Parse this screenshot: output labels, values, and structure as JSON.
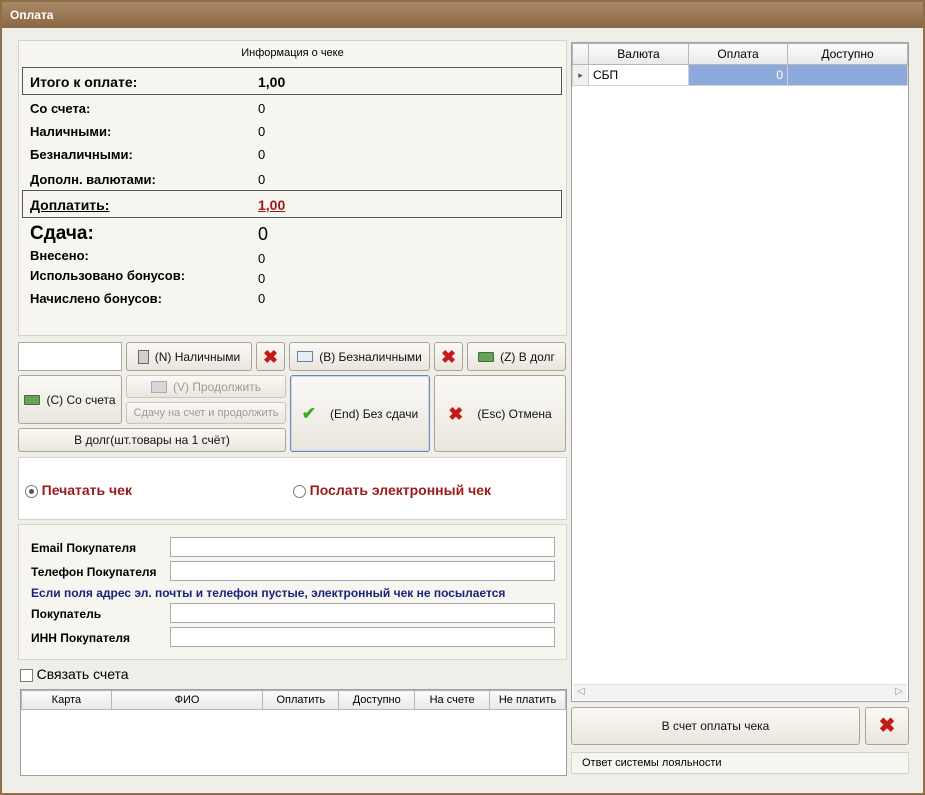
{
  "window": {
    "title": "Оплата"
  },
  "receipt": {
    "header": "Информация о чеке",
    "total_label": "Итого к оплате:",
    "total_value": "1,00",
    "from_account_label": "Со счета:",
    "from_account_value": "0",
    "cash_label": "Наличными:",
    "cash_value": "0",
    "cashless_label": "Безналичными:",
    "cashless_value": "0",
    "extra_currency_label": "Дополн. валютами:",
    "extra_currency_value": "0",
    "topay_label": "Доплатить:",
    "topay_value": "1,00",
    "change_label": "Сдача:",
    "change_value": "0",
    "deposited_label": "Внесено:",
    "deposited_value": "0",
    "bonus_used_label": "Использовано бонусов:",
    "bonus_used_value": "0",
    "bonus_accrued_label": "Начислено бонусов:",
    "bonus_accrued_value": "0"
  },
  "buttons": {
    "cash": "(N) Наличными",
    "cashless": "(B) Безналичными",
    "debt": "(Z) В долг",
    "from_account": "(C) Со счета",
    "continue": "(V) Продолжить",
    "change_to_account": "Сдачу на счет и продолжить",
    "no_change": "(End) Без сдачи",
    "cancel": "(Esc) Отмена",
    "debt_items": "В долг(шт.товары на 1 счёт)"
  },
  "print_options": {
    "print_receipt": "Печатать чек",
    "send_electronic": "Послать электронный чек"
  },
  "customer": {
    "email_label": "Email Покупателя",
    "phone_label": "Телефон Покупателя",
    "notice": "Если поля адрес эл. почты и телефон пустые, электронный чек не посылается",
    "buyer_label": "Покупатель",
    "inn_label": "ИНН Покупателя"
  },
  "link_accounts": {
    "label": "Связать счета"
  },
  "accounts_table": {
    "columns": [
      "Карта",
      "ФИО",
      "Оплатить",
      "Доступно",
      "На счете",
      "Не платить"
    ]
  },
  "currency_table": {
    "columns": [
      "Валюта",
      "Оплата",
      "Доступно"
    ],
    "rows": [
      {
        "currency": "СБП",
        "payment": "0",
        "available": ""
      }
    ]
  },
  "right_panel": {
    "apply_button": "В счет оплаты чека",
    "loyalty_label": "Ответ системы лояльности"
  },
  "colors": {
    "accent_red": "#9b1b1b",
    "notice_blue": "#1a237e",
    "selected_cell": "#8ea9db"
  }
}
